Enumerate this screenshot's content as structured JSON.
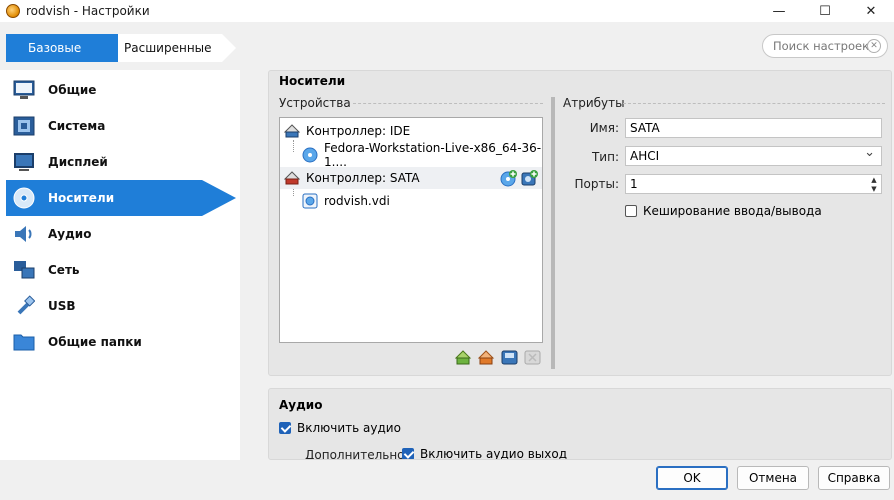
{
  "window": {
    "title": "rodvish - Настройки",
    "controls": {
      "minimize": "—",
      "maximize": "☐",
      "close": "✕"
    }
  },
  "mode_tabs": {
    "basic": "Базовые",
    "advanced": "Расширенные"
  },
  "search": {
    "placeholder": "Поиск настроек"
  },
  "sidebar": {
    "items": [
      {
        "label": "Общие",
        "icon": "general-icon"
      },
      {
        "label": "Система",
        "icon": "system-icon"
      },
      {
        "label": "Дисплей",
        "icon": "display-icon"
      },
      {
        "label": "Носители",
        "icon": "storage-icon",
        "active": true
      },
      {
        "label": "Аудио",
        "icon": "audio-icon"
      },
      {
        "label": "Сеть",
        "icon": "network-icon"
      },
      {
        "label": "USB",
        "icon": "usb-icon"
      },
      {
        "label": "Общие папки",
        "icon": "shared-folders-icon"
      }
    ]
  },
  "storage": {
    "title": "Носители",
    "devices_label": "Устройства",
    "tree": [
      {
        "label": "Контроллер: IDE",
        "type": "controller"
      },
      {
        "label": "Fedora-Workstation-Live-x86_64-36-1....",
        "type": "optical"
      },
      {
        "label": "Контроллер: SATA",
        "type": "controller",
        "selected": true
      },
      {
        "label": "rodvish.vdi",
        "type": "disk"
      }
    ],
    "attributes_label": "Атрибуты",
    "name_label": "Имя:",
    "name_value": "SATA",
    "type_label": "Тип:",
    "type_value": "AHCI",
    "ports_label": "Порты:",
    "ports_value": "1",
    "io_cache_label": "Кеширование ввода/вывода",
    "io_cache_checked": false
  },
  "audio": {
    "title": "Аудио",
    "enable_label": "Включить аудио",
    "enable_checked": true,
    "extra_label": "Дополнительно:",
    "output_label": "Включить аудио выход",
    "output_checked": true
  },
  "buttons": {
    "ok": "OK",
    "cancel": "Отмена",
    "help": "Справка"
  },
  "colors": {
    "accent": "#1f7ed8",
    "panel": "#e6e6e6"
  }
}
